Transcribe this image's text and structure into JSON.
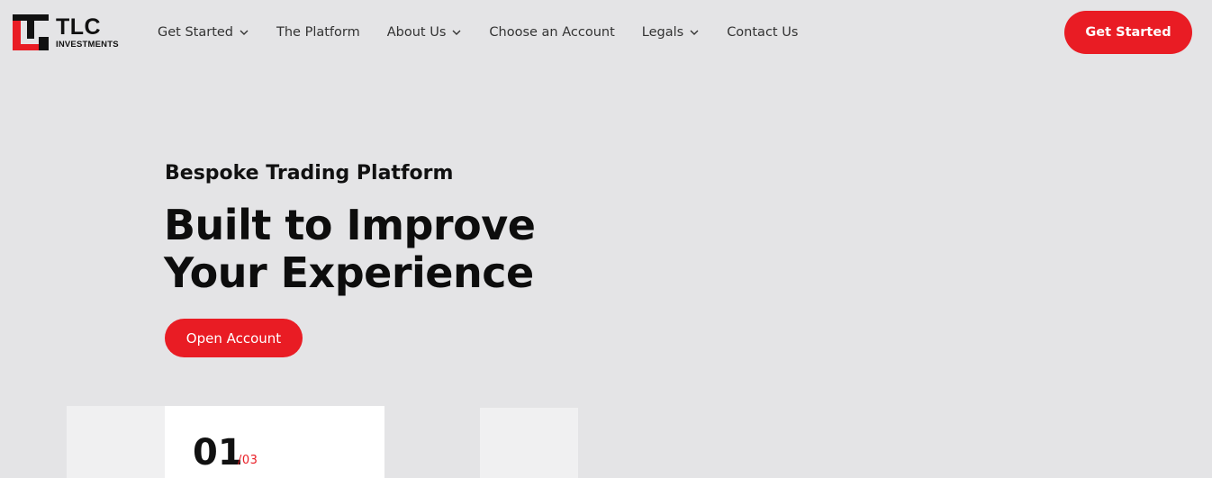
{
  "brand": {
    "name": "TLC",
    "tagline": "INVESTMENTS",
    "colors": {
      "accent": "#e91c24",
      "dark": "#111111"
    }
  },
  "nav": {
    "items": [
      {
        "label": "Get Started",
        "dropdown": true
      },
      {
        "label": "The Platform",
        "dropdown": false
      },
      {
        "label": "About Us",
        "dropdown": true
      },
      {
        "label": "Choose an Account",
        "dropdown": false
      },
      {
        "label": "Legals",
        "dropdown": true
      },
      {
        "label": "Contact Us",
        "dropdown": false
      }
    ],
    "cta_label": "Get Started"
  },
  "hero": {
    "subtitle": "Bespoke Trading Platform",
    "title_line1": "Built to Improve",
    "title_line2": "Your Experience",
    "cta_label": "Open Account"
  },
  "slider": {
    "current": "01",
    "total": "/03"
  }
}
